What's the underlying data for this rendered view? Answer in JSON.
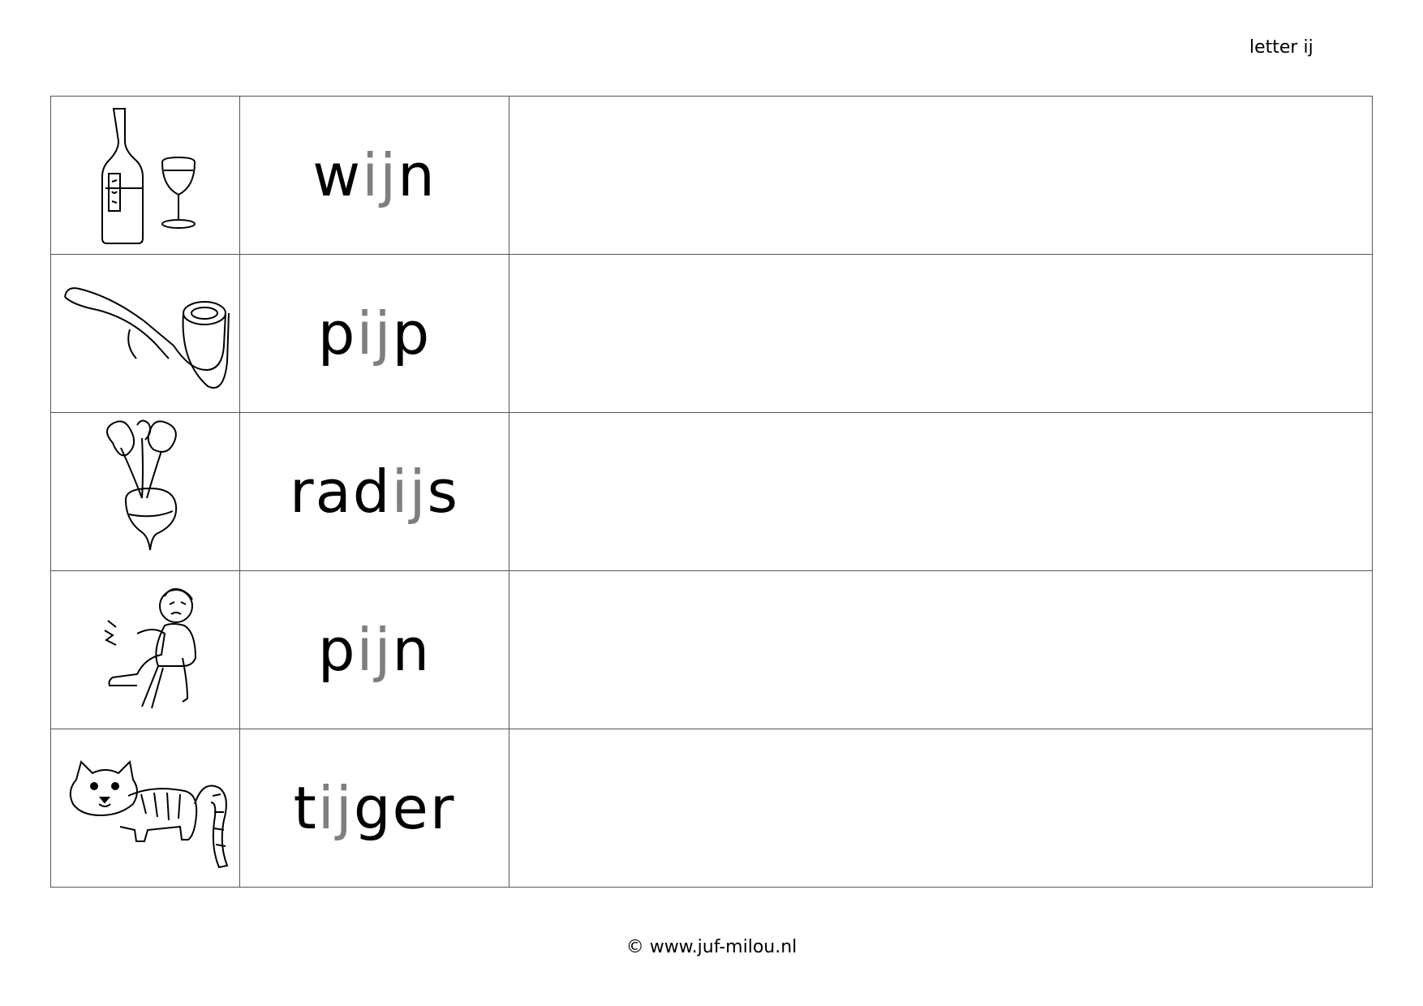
{
  "header": {
    "label": "letter ij"
  },
  "rows": [
    {
      "picture": "wine-bottle-glass-icon",
      "prefix": "w",
      "ij": "ij",
      "suffix": "n"
    },
    {
      "picture": "pipe-icon",
      "prefix": "p",
      "ij": "ij",
      "suffix": "p"
    },
    {
      "picture": "radish-icon",
      "prefix": "rad",
      "ij": "ij",
      "suffix": "s"
    },
    {
      "picture": "boy-in-pain-icon",
      "prefix": "p",
      "ij": "ij",
      "suffix": "n"
    },
    {
      "picture": "tiger-icon",
      "prefix": "t",
      "ij": "ij",
      "suffix": "ger"
    }
  ],
  "colors": {
    "highlight": "#7f7f7f",
    "text": "#000000",
    "border": "#555555"
  },
  "footer": {
    "copyright": "© www.juf-milou.nl"
  }
}
